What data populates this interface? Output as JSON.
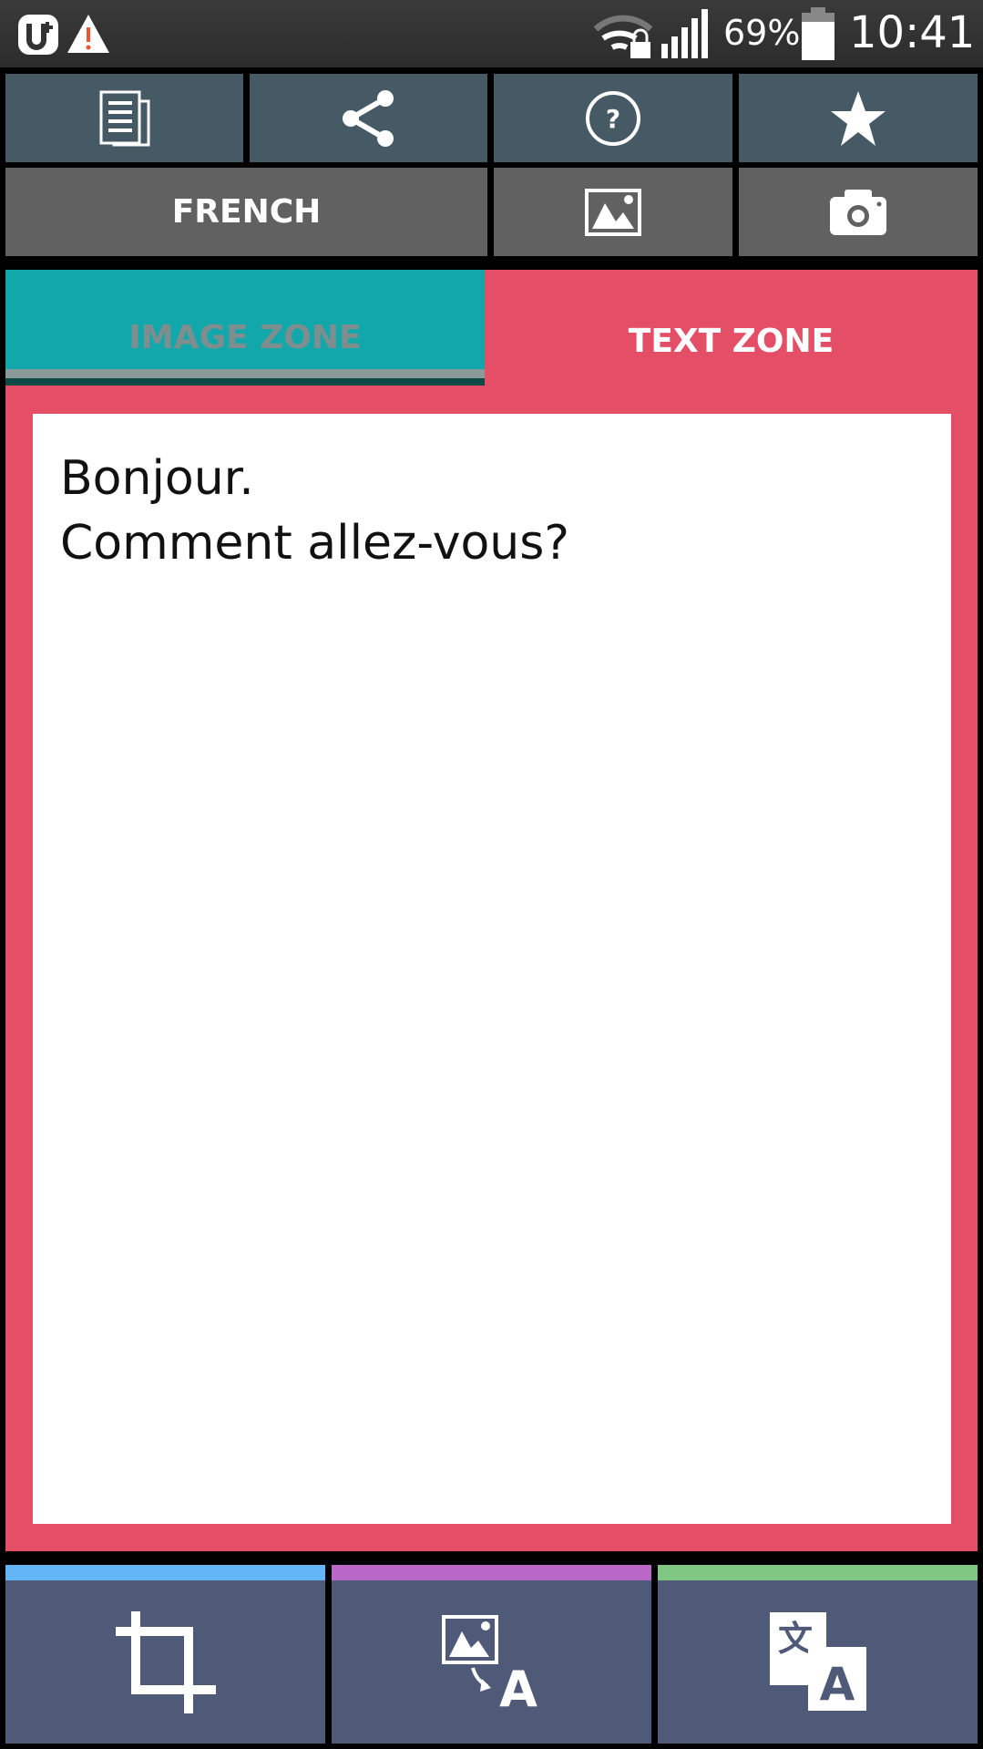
{
  "status_bar": {
    "battery": "69%",
    "time": "10:41",
    "icons": [
      "carrier-logo-icon",
      "warning-icon",
      "wifi-lock-icon",
      "signal-icon",
      "battery-icon"
    ]
  },
  "toolbar": {
    "row1": [
      {
        "icon": "copy-icon"
      },
      {
        "icon": "share-icon"
      },
      {
        "icon": "help-icon"
      },
      {
        "icon": "star-icon"
      }
    ],
    "language_label": "FRENCH",
    "row2_icons": [
      "gallery-icon",
      "camera-icon"
    ]
  },
  "tabs": [
    {
      "label": "IMAGE ZONE",
      "active": false
    },
    {
      "label": "TEXT ZONE",
      "active": true
    }
  ],
  "text_zone": {
    "content": "Bonjour.\nComment allez-vous?"
  },
  "bottom_bar": [
    {
      "icon": "crop-icon",
      "accent": "#64b5f6"
    },
    {
      "icon": "image-to-text-icon",
      "accent": "#ba68c8"
    },
    {
      "icon": "translate-icon",
      "accent": "#81c784"
    }
  ],
  "colors": {
    "toolbar_top": "#455a64",
    "toolbar_bottom": "#616161",
    "image_tab": "#12a8ab",
    "text_tab": "#e44f67",
    "bottom_bar": "#4f5978"
  }
}
